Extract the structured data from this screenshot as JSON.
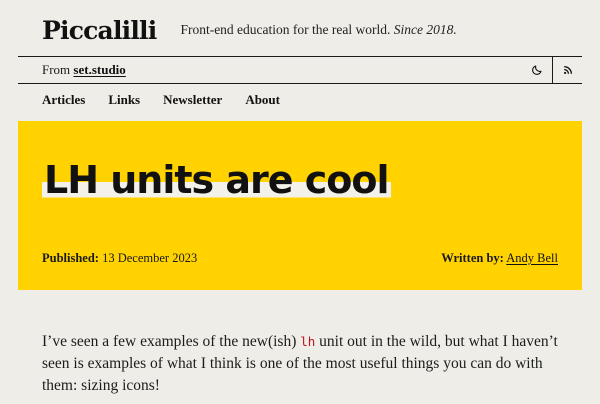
{
  "site": {
    "logo": "Piccalilli",
    "tagline": "Front-end education for the real world.",
    "tagline_since": "Since 2018."
  },
  "strip": {
    "from_prefix": "From",
    "from_link": "set.studio",
    "icons": [
      "moon-icon",
      "rss-icon"
    ]
  },
  "nav": {
    "items": [
      "Articles",
      "Links",
      "Newsletter",
      "About"
    ]
  },
  "article": {
    "title": "LH units are cool",
    "published_label": "Published:",
    "published_date": "13 December 2023",
    "author_label": "Written by:",
    "author_name": "Andy Bell",
    "intro_before": "I’ve seen a few examples of the new(ish)",
    "intro_code": "lh",
    "intro_after": "unit out in the wild, but what I haven’t seen is examples of what I think is one of the most useful things you can do with them: sizing icons!"
  },
  "colors": {
    "background": "#efede8",
    "hero": "#ffd200",
    "code": "#c1121f"
  }
}
